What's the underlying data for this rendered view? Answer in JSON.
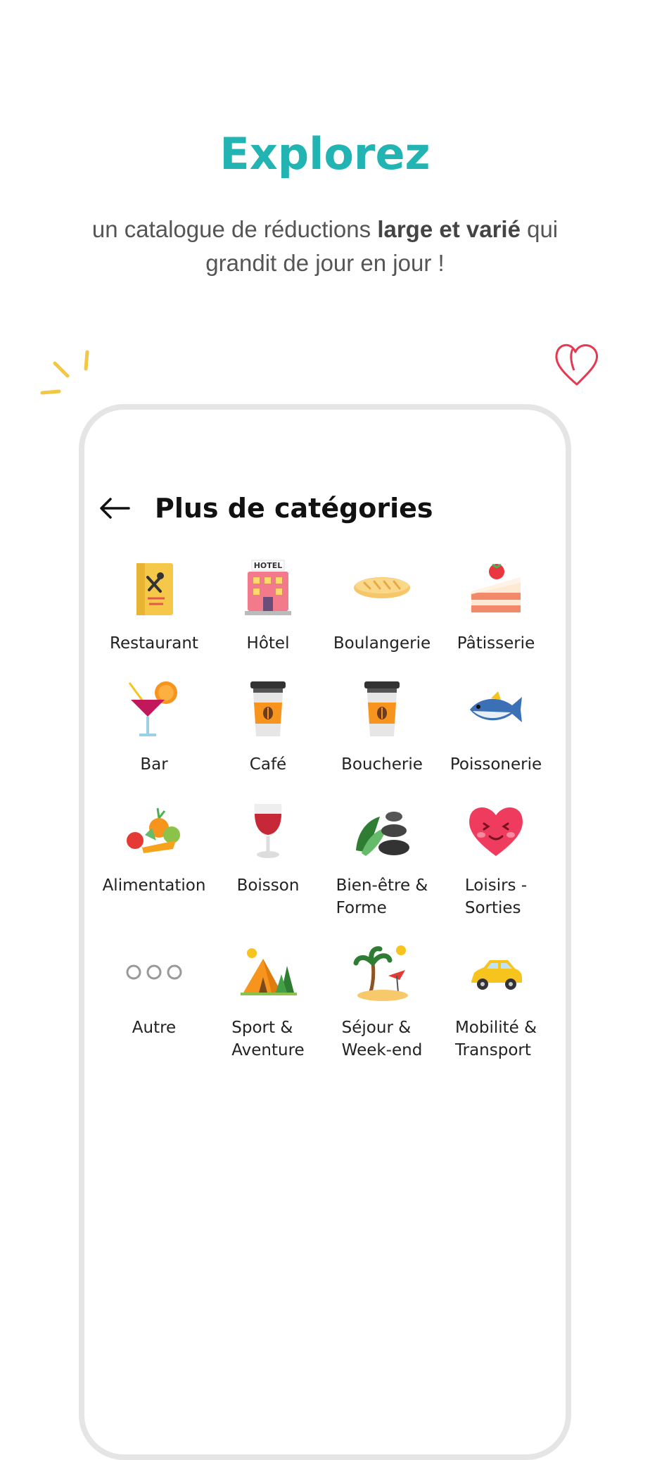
{
  "hero": {
    "title": "Explorez",
    "subtitle_pre": "un catalogue de réductions ",
    "subtitle_bold": "large et varié",
    "subtitle_post": " qui grandit de jour en jour !"
  },
  "screen": {
    "title": "Plus de catégories",
    "back_icon": "arrow-left-icon"
  },
  "categories": [
    {
      "label": "Restaurant",
      "icon": "restaurant-menu-icon"
    },
    {
      "label": "Hôtel",
      "icon": "hotel-icon"
    },
    {
      "label": "Boulangerie",
      "icon": "baguette-icon"
    },
    {
      "label": "Pâtisserie",
      "icon": "cake-icon"
    },
    {
      "label": "Bar",
      "icon": "cocktail-icon"
    },
    {
      "label": "Café",
      "icon": "coffee-cup-icon"
    },
    {
      "label": "Boucherie",
      "icon": "coffee-cup-icon"
    },
    {
      "label": "Poissonerie",
      "icon": "fish-icon"
    },
    {
      "label": "Alimentation",
      "icon": "vegetables-icon"
    },
    {
      "label": "Boisson",
      "icon": "wine-glass-icon"
    },
    {
      "label": "Bien-être &\nForme",
      "icon": "spa-stones-icon"
    },
    {
      "label": "Loisirs -\nSorties",
      "icon": "heart-face-icon"
    },
    {
      "label": "Autre",
      "icon": "more-dots-icon"
    },
    {
      "label": "Sport &\nAventure",
      "icon": "tent-icon"
    },
    {
      "label": "Séjour &\nWeek-end",
      "icon": "palm-beach-icon"
    },
    {
      "label": "Mobilité &\nTransport",
      "icon": "car-icon"
    }
  ],
  "colors": {
    "accent": "#22b3b3",
    "text": "#555555",
    "frame": "#e5e5e5"
  }
}
